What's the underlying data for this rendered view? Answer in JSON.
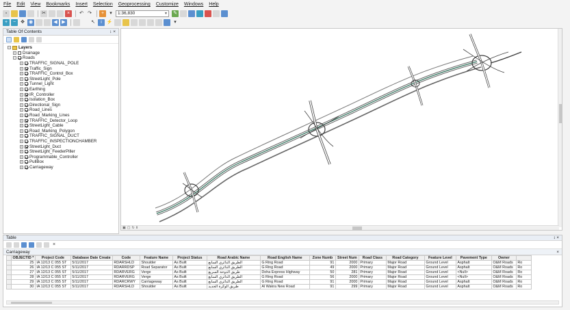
{
  "menu": [
    "File",
    "Edit",
    "View",
    "Bookmarks",
    "Insert",
    "Selection",
    "Geoprocessing",
    "Customize",
    "Windows",
    "Help"
  ],
  "toolbar": {
    "scale": "1:36,830"
  },
  "toc": {
    "title": "Table Of Contents",
    "title_controls": "↕ ×",
    "root": "Layers",
    "groups": [
      {
        "label": "Drainage",
        "checked": false
      },
      {
        "label": "Roads",
        "checked": true
      }
    ],
    "layers": [
      "TRAFFIC_SIGNAL_POLE",
      "Traffic_Sign",
      "TRAFFIC_Control_Box",
      "StreetLight_Pole",
      "Tunnel_Light",
      "Earthing",
      "IR_Controller",
      "Isolation_Box",
      "Directional_Sign",
      "Road_Lines",
      "Road_Marking_Lines",
      "TRAFFIC_Detector_Loop",
      "StreetLight_Cable",
      "Road_Marking_Polygon",
      "TRAFFIC_SIGNAL_DUCT",
      "TRAFFIC_INSPECTIONCHAMBER",
      "StreetLight_Duct",
      "StreetLight_FeederPiller",
      "Programmable_Controller",
      "PullBox",
      "Carriageway"
    ]
  },
  "table": {
    "panel_title": "Table",
    "panel_controls": "↕ ×",
    "tab": "Carriageway",
    "tab_close": "×",
    "columns": [
      "OBJECTID *",
      "Project Code",
      "Database Date Create",
      "Code",
      "Feature Name",
      "Project Status",
      "Road Arabic Name",
      "Road English Name",
      "Zone Numb",
      "Street Num",
      "Road Class",
      "Road Category",
      "Feature Level",
      "Pavement Type",
      "Owner",
      ""
    ],
    "rows": [
      [
        "25",
        "IA 12/13 C 055 ST",
        "5/11/2017",
        "RDARSHLD",
        "Shoulder",
        "As Built",
        "الطريق الدائري السابع",
        "G Ring Road",
        "91",
        "2000",
        "Primary",
        "Major Road",
        "Ground Level",
        "Asphalt",
        "O&M Roads",
        "Ro"
      ],
      [
        "26",
        "IA 12/13 C 055 ST",
        "5/11/2017",
        "RDARRDSP",
        "Road Separator",
        "As Built",
        "الطريق الدائري السابع",
        "G Ring Road",
        "49",
        "2000",
        "Primary",
        "Major Road",
        "Ground Level",
        "Asphalt",
        "O&M Roads",
        "Ro"
      ],
      [
        "27",
        "IA 12/13 C 055 ST",
        "5/11/2017",
        "RDARVERG",
        "Verge",
        "As Built",
        "طريق الدوحة السريع",
        "Doha Express Highway",
        "50",
        "281",
        "Primary",
        "Major Road",
        "Ground Level",
        "<Null>",
        "O&M Roads",
        "Ro"
      ],
      [
        "28",
        "IA 12/13 C 055 ST",
        "5/11/2017",
        "RDARVERG",
        "Verge",
        "As Built",
        "الطريق الدائري السابع",
        "G Ring Road",
        "56",
        "2000",
        "Primary",
        "Major Road",
        "Ground Level",
        "<Null>",
        "O&M Roads",
        "Ro"
      ],
      [
        "29",
        "IA 12/13 C 055 ST",
        "5/11/2017",
        "RDARCRWY",
        "Carriageway",
        "As Built",
        "الطريق الدائري السابع",
        "G Ring Road",
        "91",
        "2000",
        "Primary",
        "Major Road",
        "Ground Level",
        "Asphalt",
        "O&M Roads",
        "Ro"
      ],
      [
        "30",
        "IA 12/13 C 055 ST",
        "5/11/2017",
        "RDARSHLD",
        "Shoulder",
        "As Built",
        "طريق الوكرة الجديد",
        "Al Wakra New Road",
        "91",
        "299",
        "Primary",
        "Major Road",
        "Ground Level",
        "Asphalt",
        "O&M Roads",
        "Ro"
      ]
    ]
  }
}
